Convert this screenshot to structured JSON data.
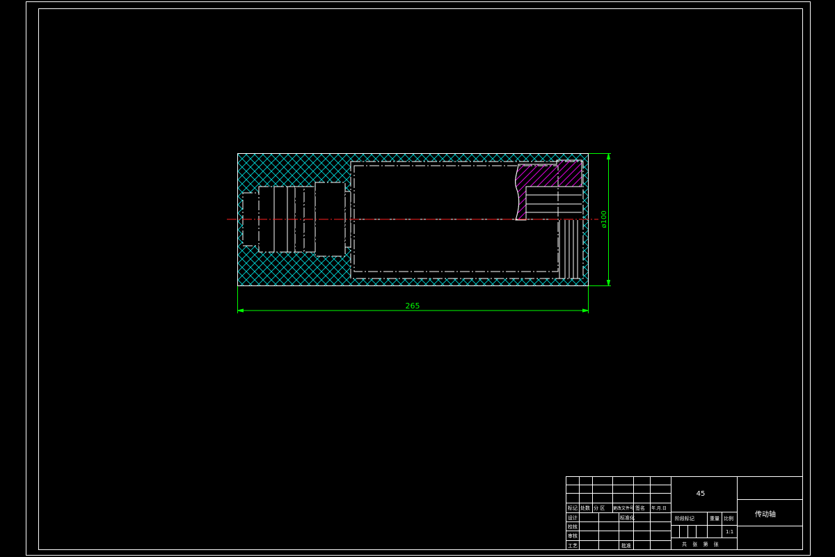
{
  "drawing": {
    "dimension_length": "265",
    "dimension_diameter": "ø100"
  },
  "title_block": {
    "material": "45",
    "part_name": "传动轴",
    "header_row": [
      "标记",
      "处数",
      "分 区",
      "更改文件号",
      "签名",
      "年.月.日"
    ],
    "row_design": "设计",
    "row_standardization": "标准化",
    "row_check": "校核",
    "row_review": "审核",
    "row_process": "工艺",
    "row_approve": "批准",
    "stage_mark": "阶段标记",
    "weight": "重量",
    "scale_label": "比例",
    "scale_value": "1:1",
    "sheet_info": "共 张 第 张"
  },
  "colors": {
    "background": "#000000",
    "frame": "#ffffff",
    "hatch": "#00ffff",
    "hatch_section": "#ff00ff",
    "dimension": "#00ff00",
    "centerline": "#ff0000"
  }
}
